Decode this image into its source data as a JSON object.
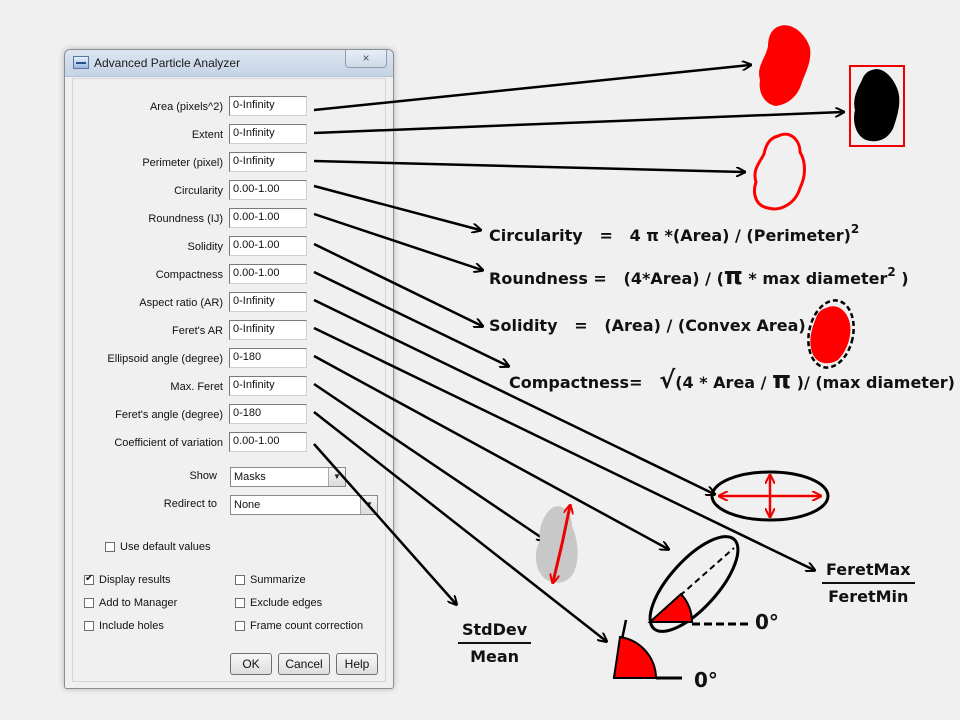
{
  "dialog": {
    "title": "Advanced Particle Analyzer",
    "close_glyph": "×",
    "fields": [
      {
        "label": "Area (pixels^2)",
        "value": "0-Infinity"
      },
      {
        "label": "Extent",
        "value": "0-Infinity"
      },
      {
        "label": "Perimeter (pixel)",
        "value": "0-Infinity"
      },
      {
        "label": "Circularity",
        "value": "0.00-1.00"
      },
      {
        "label": "Roundness (IJ)",
        "value": "0.00-1.00"
      },
      {
        "label": "Solidity",
        "value": "0.00-1.00"
      },
      {
        "label": "Compactness",
        "value": "0.00-1.00"
      },
      {
        "label": "Aspect ratio (AR)",
        "value": "0-Infinity"
      },
      {
        "label": "Feret's AR",
        "value": "0-Infinity"
      },
      {
        "label": "Ellipsoid angle (degree)",
        "value": "0-180"
      },
      {
        "label": "Max. Feret",
        "value": "0-Infinity"
      },
      {
        "label": "Feret's angle (degree)",
        "value": "0-180"
      },
      {
        "label": "Coefficient of variation",
        "value": "0.00-1.00"
      }
    ],
    "show": {
      "label": "Show",
      "value": "Masks"
    },
    "redirect": {
      "label": "Redirect to",
      "value": "None"
    },
    "checkboxes": {
      "use_default": {
        "label": "Use default values",
        "checked": false
      },
      "display_results": {
        "label": "Display results",
        "checked": true
      },
      "summarize": {
        "label": "Summarize",
        "checked": false
      },
      "add_to_manager": {
        "label": "Add to Manager",
        "checked": false
      },
      "exclude_edges": {
        "label": "Exclude edges",
        "checked": false
      },
      "include_holes": {
        "label": "Include holes",
        "checked": false
      },
      "frame_count": {
        "label": "Frame count correction",
        "checked": false
      }
    },
    "buttons": {
      "ok": "OK",
      "cancel": "Cancel",
      "help": "Help"
    }
  },
  "annotations": {
    "circularity": {
      "name": "Circularity",
      "eq": "=",
      "formula": "4 π *(Area) / (Perimeter)",
      "sup": "2"
    },
    "roundness": {
      "name": "Roundness =",
      "part1": "(4*Area) / (",
      "pi": "π",
      "part2": " * max diameter",
      "sup": "2",
      "close": " )"
    },
    "solidity": {
      "name": "Solidity",
      "eq": "=",
      "formula": "(Area) / (Convex Area)"
    },
    "compactness": {
      "name": "Compactness=",
      "sqrt": "√",
      "part1": "(4 * Area / ",
      "pi": "π",
      "part2": " )/ (max diameter)"
    },
    "stddev_mean": {
      "num": "StdDev",
      "den": "Mean"
    },
    "feret_ratio": {
      "num": "FeretMax",
      "den": "FeretMin"
    },
    "zero_deg_1": "0°",
    "zero_deg_2": "0°"
  },
  "colors": {
    "accent": "#ff0000",
    "shape_gray": "#c8c8c8",
    "ink": "#000000"
  }
}
